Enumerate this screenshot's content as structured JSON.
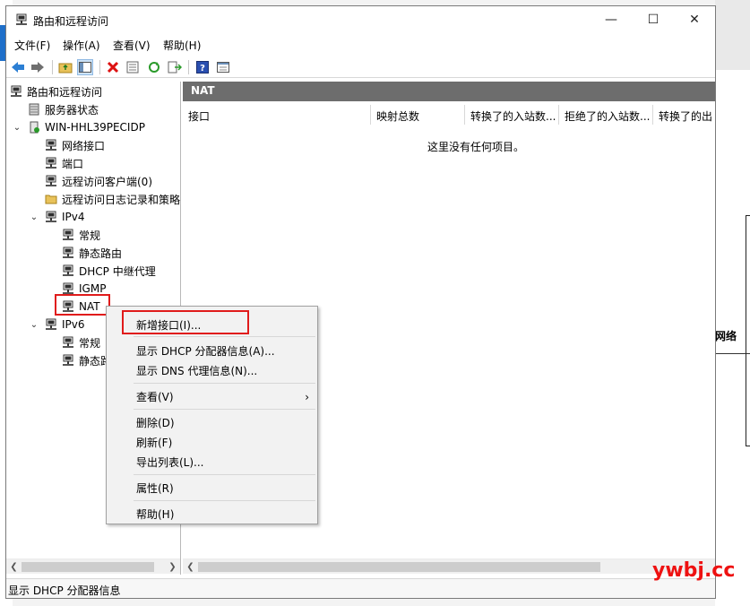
{
  "window": {
    "title": "路由和远程访问"
  },
  "window_controls": {
    "minimize": "—",
    "maximize": "☐",
    "close": "✕"
  },
  "menu": [
    "文件(F)",
    "操作(A)",
    "查看(V)",
    "帮助(H)"
  ],
  "toolbar_icons": [
    "back-icon",
    "forward-icon",
    "up-folder-icon",
    "show-tree-icon",
    "delete-icon",
    "properties-icon",
    "refresh-icon",
    "export-icon",
    "help-icon",
    "mmc-icon"
  ],
  "tree": {
    "root": "路由和远程访问",
    "server_status": "服务器状态",
    "server": "WIN-HHL39PECIDP",
    "network_interfaces": "网络接口",
    "ports": "端口",
    "remote_clients": "远程访问客户端(0)",
    "remote_logging": "远程访问日志记录和策略",
    "ipv4": "IPv4",
    "ipv4_general": "常规",
    "ipv4_static": "静态路由",
    "ipv4_dhcp": "DHCP 中继代理",
    "ipv4_igmp": "IGMP",
    "ipv4_nat": "NAT",
    "ipv6": "IPv6",
    "ipv6_general": "常规",
    "ipv6_static": "静态路由"
  },
  "details": {
    "header": "NAT",
    "columns": [
      "接口",
      "映射总数",
      "转换了的入站数...",
      "拒绝了的入站数...",
      "转换了的出"
    ],
    "empty_message": "这里没有任何项目。"
  },
  "context_menu": {
    "new_interface": "新增接口(I)...",
    "show_dhcp": "显示 DHCP 分配器信息(A)...",
    "show_dns": "显示 DNS 代理信息(N)...",
    "view": "查看(V)",
    "delete": "删除(D)",
    "refresh": "刷新(F)",
    "export": "导出列表(L)...",
    "properties": "属性(R)",
    "help": "帮助(H)"
  },
  "status_bar": "显示 DHCP 分配器信息",
  "background": {
    "network_label": "网络",
    "watermark": "ywbj.cc"
  },
  "colors": {
    "highlight_box": "#e01b1b",
    "pane_header": "#6d6d6d"
  }
}
